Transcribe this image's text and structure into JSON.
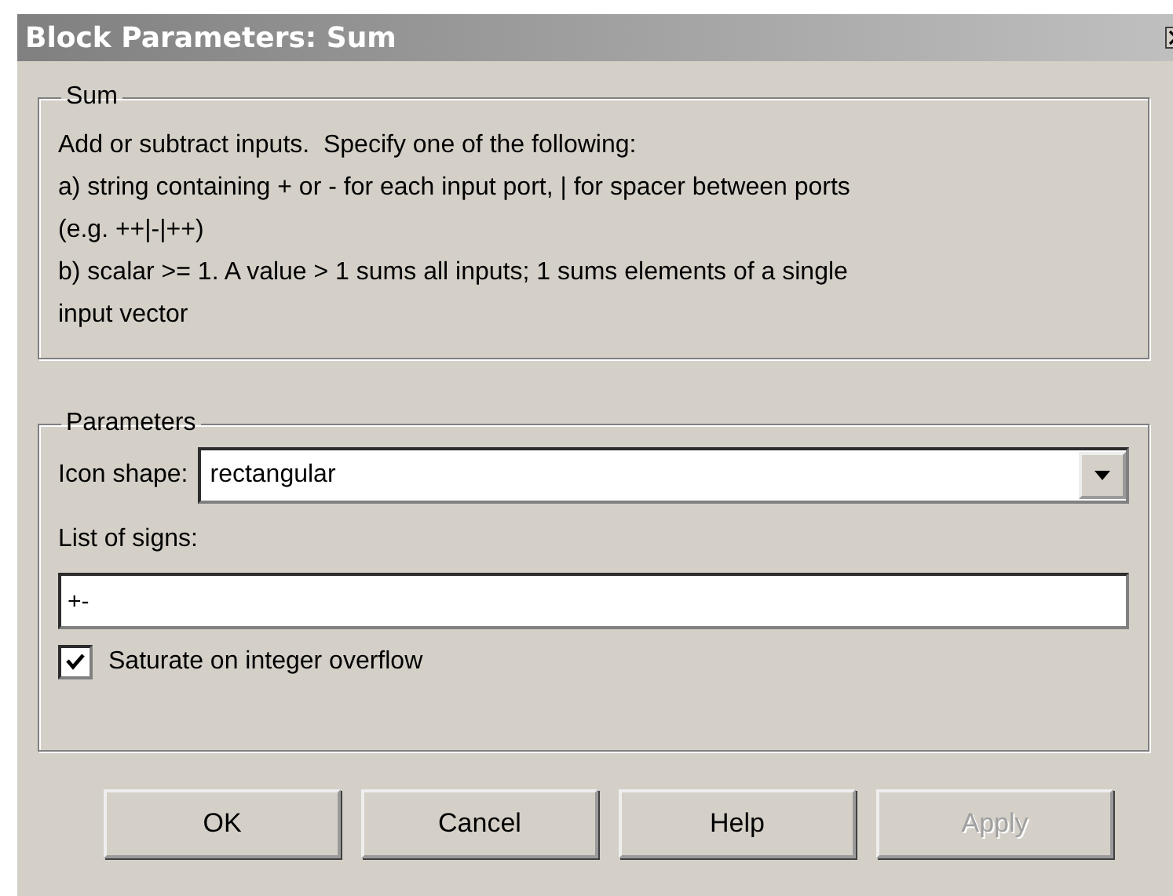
{
  "window": {
    "title": "Block Parameters: Sum"
  },
  "description_group": {
    "title": "Sum",
    "lines": [
      "Add or subtract inputs.  Specify one of the following:",
      "a) string containing + or - for each input port, | for spacer between ports",
      "(e.g. ++|-|++)",
      "b) scalar >= 1. A value > 1 sums all inputs; 1 sums elements of a single",
      "input vector"
    ]
  },
  "parameters_group": {
    "title": "Parameters",
    "icon_shape": {
      "label": "Icon shape:",
      "value": "rectangular"
    },
    "list_of_signs": {
      "label": "List of signs:",
      "value": "+-"
    },
    "saturate": {
      "label": "Saturate on integer overflow",
      "checked": true
    }
  },
  "buttons": [
    {
      "label": "OK",
      "disabled": false
    },
    {
      "label": "Cancel",
      "disabled": false
    },
    {
      "label": "Help",
      "disabled": false
    },
    {
      "label": "Apply",
      "disabled": true
    }
  ]
}
